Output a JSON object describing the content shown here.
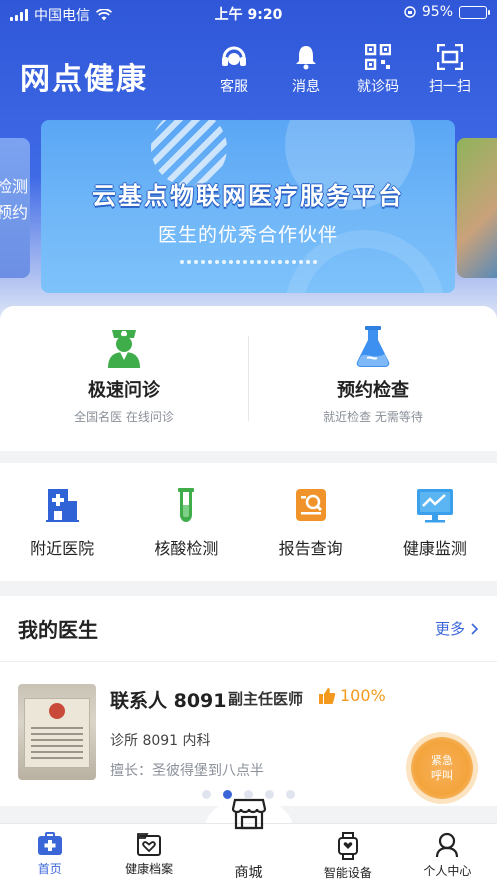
{
  "status_bar": {
    "carrier": "中国电信",
    "time": "上午 9:20",
    "battery": "95%"
  },
  "header": {
    "title": "网点健康",
    "actions": [
      {
        "label": "客服",
        "icon": "customer-service-icon"
      },
      {
        "label": "消息",
        "icon": "bell-icon"
      },
      {
        "label": "就诊码",
        "icon": "qr-code-icon"
      },
      {
        "label": "扫一扫",
        "icon": "scan-icon"
      }
    ]
  },
  "banner": {
    "title": "云基点物联网医疗服务平台",
    "subtitle": "医生的优秀合作伙伴",
    "side_left_text": [
      "检测",
      "预约"
    ]
  },
  "primary_services": [
    {
      "title": "极速问诊",
      "subtitle": "全国名医 在线问诊",
      "icon": "doctor-icon"
    },
    {
      "title": "预约检查",
      "subtitle": "就近检查 无需等待",
      "icon": "flask-icon"
    }
  ],
  "services": [
    {
      "label": "附近医院",
      "icon": "hospital-icon"
    },
    {
      "label": "核酸检测",
      "icon": "test-tube-icon"
    },
    {
      "label": "报告查询",
      "icon": "report-search-icon"
    },
    {
      "label": "健康监测",
      "icon": "monitor-icon"
    }
  ],
  "my_doctor": {
    "title": "我的医生",
    "more_label": "更多",
    "doctor": {
      "name": "联系人 8091",
      "title": "副主任医师",
      "rating": "100%",
      "department": "诊所 8091 内科",
      "specialty": "擅长：圣彼得堡到八点半"
    },
    "pagination": {
      "total": 5,
      "active": 1
    }
  },
  "emergency_button": {
    "line1": "紧急",
    "line2": "呼叫"
  },
  "tabbar": [
    {
      "label": "首页",
      "icon": "home-medical-icon",
      "active": true
    },
    {
      "label": "健康档案",
      "icon": "health-record-icon",
      "active": false
    },
    {
      "label": "商城",
      "icon": "store-icon",
      "active": false
    },
    {
      "label": "智能设备",
      "icon": "smartwatch-icon",
      "active": false
    },
    {
      "label": "个人中心",
      "icon": "user-icon",
      "active": false
    }
  ],
  "colors": {
    "primary": "#3a66d8",
    "accent_orange": "#f39a1e",
    "icon_green": "#3fae4a",
    "icon_blue": "#2f63d6"
  }
}
